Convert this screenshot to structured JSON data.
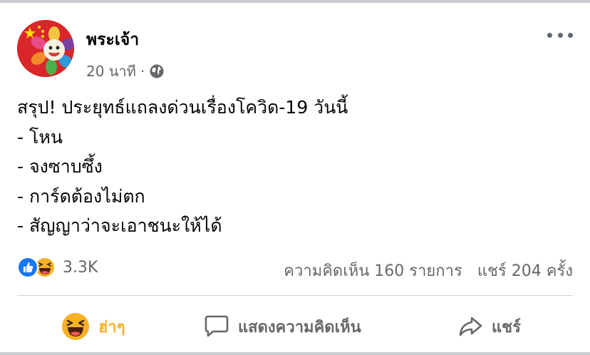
{
  "post": {
    "author": "พระเจ้า",
    "time": "20 นาที",
    "separator": "·",
    "privacy_icon": "globe-icon",
    "lines": [
      "สรุป! ประยุทธ์แถลงด่วนเรื่องโควิด-19 วันนี้",
      "- โหน",
      "- จงซาบซึ้ง",
      "- การ์ดต้องไม่ตก",
      "- สัญญาว่าจะเอาชนะให้ได้"
    ]
  },
  "stats": {
    "reaction_icons": [
      "like-icon",
      "haha-icon"
    ],
    "reaction_count": "3.3K",
    "comments": "ความคิดเห็น 160 รายการ",
    "shares": "แชร์ 204 ครั้ง"
  },
  "actions": {
    "react_label": "ฮ่าๆ",
    "comment_label": "แสดงความคิดเห็น",
    "share_label": "แชร์"
  },
  "colors": {
    "like_blue": "#1877f2",
    "haha_yellow": "#f7b125",
    "muted_text": "#65676b"
  }
}
